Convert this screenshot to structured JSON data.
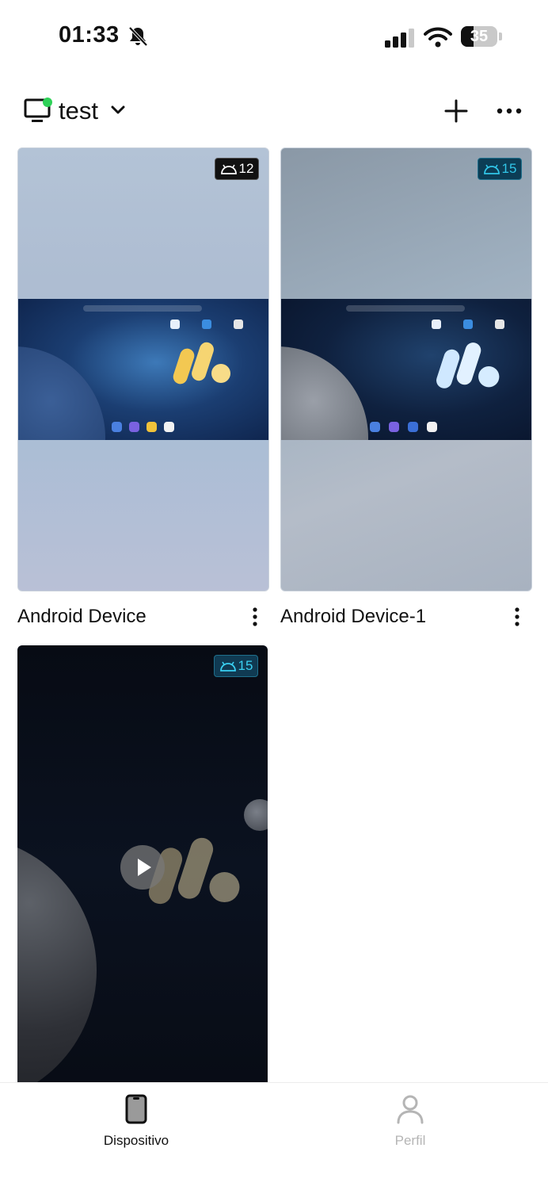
{
  "status_bar": {
    "time": "01:33",
    "battery_level": "35",
    "battery_percent": 35,
    "icons": [
      "bell-slash-icon",
      "signal-icon",
      "wifi-icon",
      "battery-icon"
    ]
  },
  "header": {
    "title": "test",
    "status_color": "#2fd158",
    "icons": [
      "monitor-icon",
      "chevron-down-icon",
      "plus-icon",
      "more-horizontal-icon"
    ]
  },
  "devices": [
    {
      "name": "Android Device",
      "android_version": "12",
      "badge_color": "#111111"
    },
    {
      "name": "Android Device-1",
      "android_version": "15",
      "badge_color": "#0c3d55"
    },
    {
      "name": "",
      "android_version": "15",
      "badge_color": "#103a52"
    }
  ],
  "bottom_nav": {
    "items": [
      {
        "label": "Dispositivo",
        "icon": "phone-icon",
        "active": true
      },
      {
        "label": "Perfil",
        "icon": "person-icon",
        "active": false
      }
    ],
    "active_color": "#111111",
    "inactive_color": "#b5b5b5"
  }
}
